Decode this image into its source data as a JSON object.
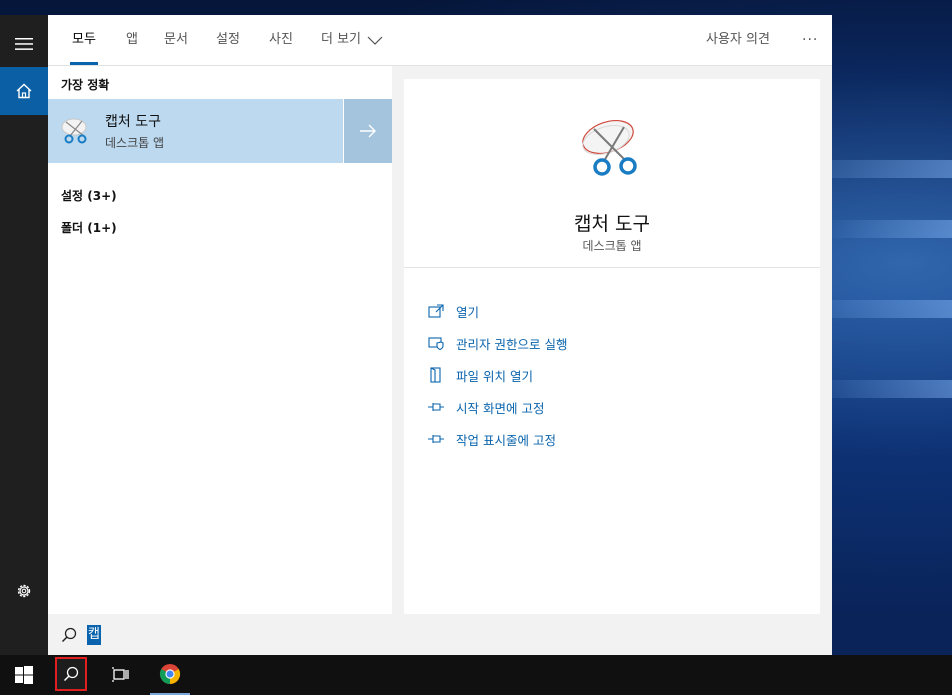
{
  "tabs": [
    {
      "label": "모두",
      "active": true
    },
    {
      "label": "앱"
    },
    {
      "label": "문서"
    },
    {
      "label": "설정"
    },
    {
      "label": "사진"
    },
    {
      "label": "더 보기"
    }
  ],
  "feedback_label": "사용자 의견",
  "more_options": "···",
  "results": {
    "best_match_header": "가장 정확",
    "best_match": {
      "title": "캡처 도구",
      "subtitle": "데스크톱 앱"
    },
    "settings_header": "설정 (3+)",
    "folders_header": "폴더 (1+)"
  },
  "detail": {
    "title": "캡처 도구",
    "subtitle": "데스크톱 앱",
    "actions": [
      {
        "label": "열기",
        "icon": "open-icon"
      },
      {
        "label": "관리자 권한으로 실행",
        "icon": "shield-run-as-admin-icon"
      },
      {
        "label": "파일 위치 열기",
        "icon": "file-location-icon"
      },
      {
        "label": "시작 화면에 고정",
        "icon": "pin-icon"
      },
      {
        "label": "작업 표시줄에 고정",
        "icon": "pin-icon"
      }
    ]
  },
  "search": {
    "query": "캡"
  },
  "colors": {
    "accent": "#0a64ad",
    "selected": "#bcd9f0",
    "rail": "#1f1f1f",
    "taskbar": "#101010"
  }
}
